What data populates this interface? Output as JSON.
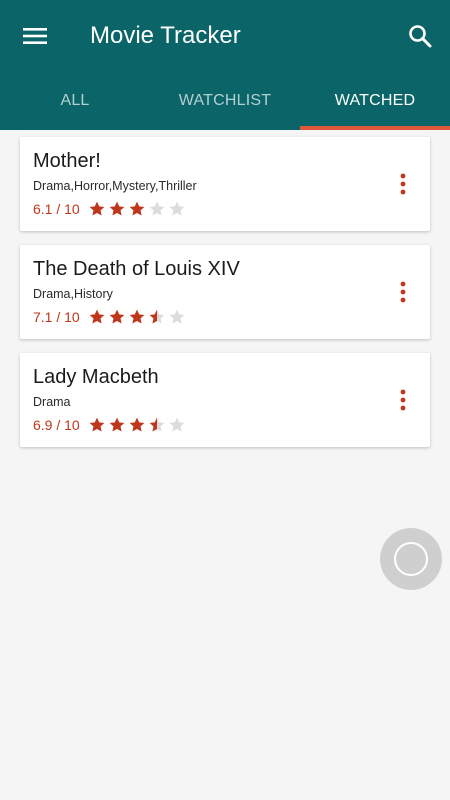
{
  "app": {
    "title": "Movie Tracker",
    "icons": {
      "menu": "menu-icon",
      "search": "search-icon",
      "more": "more-vert-icon",
      "star": "star-icon"
    },
    "colors": {
      "primary": "#0b6467",
      "accent": "#e0573c",
      "rating": "#c0361b",
      "star_empty": "#dcdcdc"
    }
  },
  "tabs": [
    {
      "label": "ALL",
      "active": false
    },
    {
      "label": "WATCHLIST",
      "active": false
    },
    {
      "label": "WATCHED",
      "active": true
    }
  ],
  "movies": [
    {
      "title": "Mother!",
      "genres": "Drama,Horror,Mystery,Thriller",
      "rating_text": "6.1 / 10",
      "stars": 3,
      "stars_max": 5
    },
    {
      "title": "The Death of Louis XIV",
      "genres": "Drama,History",
      "rating_text": "7.1 / 10",
      "stars": 3.5,
      "stars_max": 5
    },
    {
      "title": "Lady Macbeth",
      "genres": "Drama",
      "rating_text": "6.9 / 10",
      "stars": 3.5,
      "stars_max": 5
    }
  ],
  "fab": {
    "icon": "circle-icon"
  }
}
